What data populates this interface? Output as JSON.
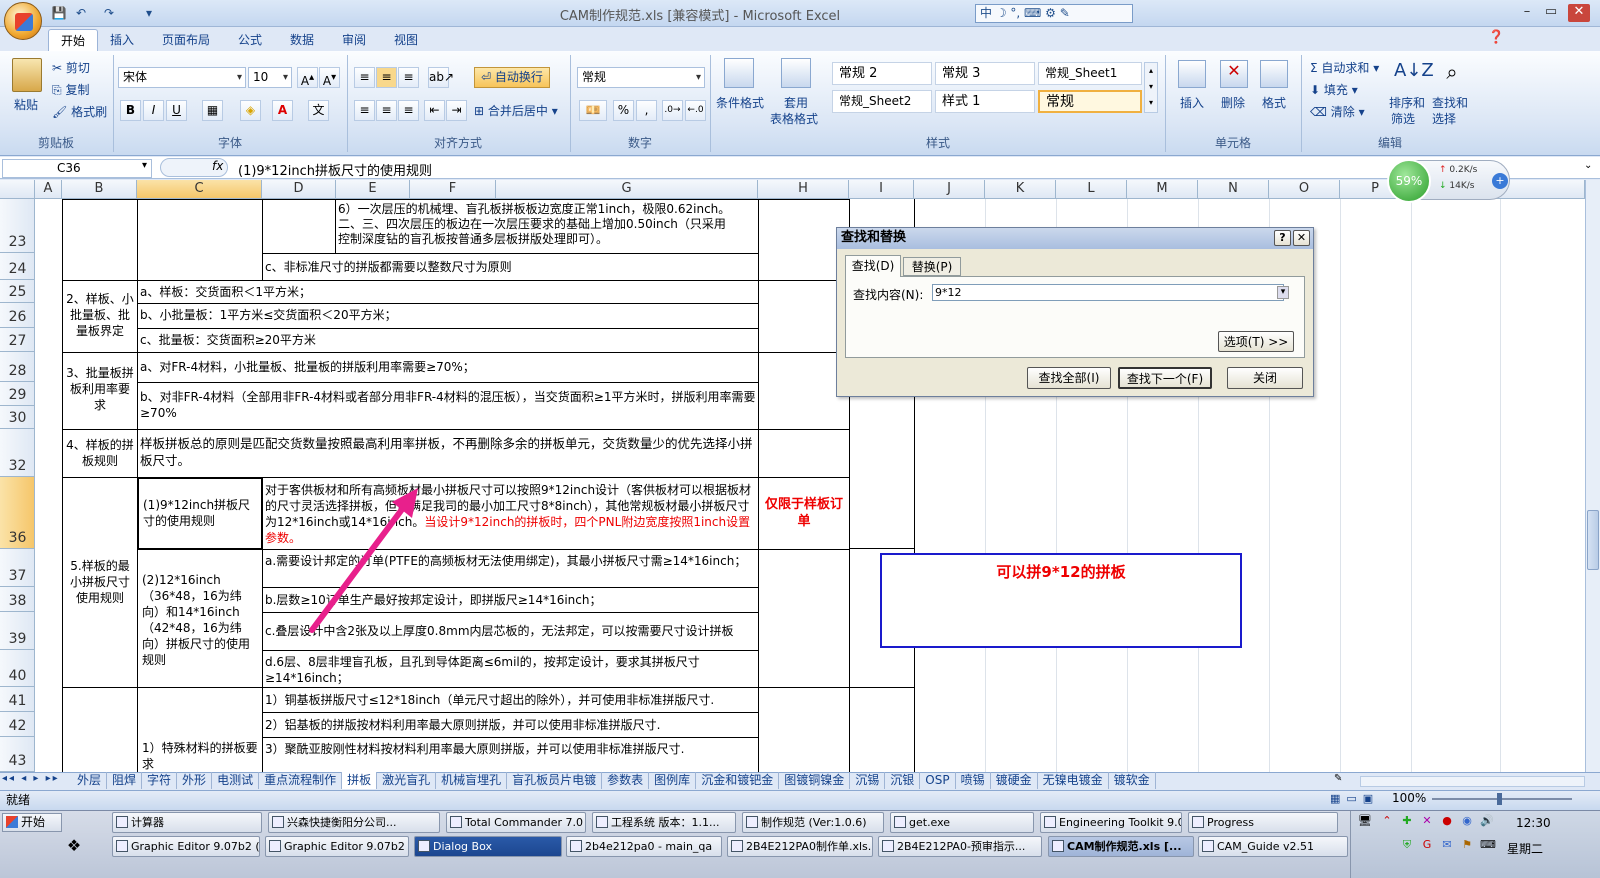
{
  "window": {
    "title": "CAM制作规范.xls  [兼容模式] - Microsoft Excel",
    "ime": "中 ☽ ° ⌨ 👤 🔧",
    "ime_lang": "中"
  },
  "tabs": [
    "开始",
    "插入",
    "页面布局",
    "公式",
    "数据",
    "审阅",
    "视图"
  ],
  "ribbon": {
    "clipboard": {
      "paste": "粘贴",
      "cut": "剪切",
      "copy": "复制",
      "format_painter": "格式刷",
      "label": "剪贴板"
    },
    "font": {
      "name": "宋体",
      "size": "10",
      "bold": "B",
      "italic": "I",
      "underline": "U",
      "label": "字体"
    },
    "alignment": {
      "wrap": "自动换行",
      "merge": "合并后居中",
      "label": "对齐方式"
    },
    "number": {
      "format": "常规",
      "label": "数字",
      "percent": "%",
      "comma": ","
    },
    "styles": {
      "conditional": "条件格式",
      "table": "套用",
      "table2": "表格格式",
      "cells": [
        "常规 2",
        "常规 3",
        "常规_Sheet1",
        "常规_Sheet2",
        "样式 1",
        "常规"
      ],
      "label": "样式"
    },
    "cells": {
      "insert": "插入",
      "delete": "删除",
      "format": "格式",
      "label": "单元格"
    },
    "editing": {
      "autosum": "自动求和",
      "fill": "填充",
      "clear": "清除",
      "sort": "排序和",
      "sort2": "筛选",
      "find": "查找和",
      "find2": "选择",
      "label": "编辑"
    }
  },
  "formula_bar": {
    "name_box": "C36",
    "fx": "fx",
    "content": "(1)9*12inch拼板尺寸的使用规则"
  },
  "columns": [
    "A",
    "B",
    "C",
    "D",
    "E",
    "F",
    "G",
    "H",
    "I",
    "J",
    "K",
    "L",
    "M",
    "N",
    "O",
    "P",
    "R"
  ],
  "rows": [
    "23",
    "24",
    "25",
    "26",
    "27",
    "28",
    "29",
    "30",
    "31",
    "32",
    "36",
    "37",
    "38",
    "39",
    "40",
    "41",
    "42",
    "43"
  ],
  "sheet": {
    "r23_line1": "6）一次层压的机械埋、盲孔板拼板板边宽度正常1inch，极限0.62inch。",
    "r23_line2": "二、三、四次层压的板边在一次层压要求的基础上增加0.50inch（只采用",
    "r23_line3": "控制深度钻的盲孔板按普通多层板拼版处理即可）。",
    "r24": "c、非标准尺寸的拼版都需要以整数尺寸为原则",
    "b25": "2、样板、小批量板、批量板界定",
    "c25": "a、样板：交货面积＜1平方米；",
    "c26": "b、小批量板：1平方米≤交货面积＜20平方米；",
    "c27": "c、批量板：交货面积≥20平方米",
    "b29": "3、批量板拼板利用率要求",
    "c29": "a、对FR-4材料，小批量板、批量板的拼版利用率需要≥70%；",
    "c30": "b、对非FR-4材料（全部用非FR-4材料或者部分用非FR-4材料的混压板），当交货面积≥1平方米时，拼版利用率需要≥70%",
    "b32": "4、样板的拼板规则",
    "c32": "样板拼板总的原则是匹配交货数量按照最高利用率拼板，不再删除多余的拼板单元，交货数量少的优先选择小拼板尺寸。",
    "b36": "5.样板的最小拼板尺寸使用规则",
    "c36": "(1)9*12inch拼板尺寸的使用规则",
    "d36_black": "对于客供板材和所有高频板材最小拼板尺寸可以按照9*12inch设计（客供板材可以根据板材的尺寸灵活选择拼板，但需满足我司的最小加工尺寸8*8inch），其他常规板材最小拼板尺寸为12*16inch或14*16inch。",
    "d36_red": "当设计9*12inch的拼板时，四个PNL附边宽度按照1inch设置参数。",
    "h36": "仅限于样板订单",
    "c37": "(2)12*16inch（36*48，16为纬向）和14*16inch（42*48，16为纬向）拼板尺寸的使用规则",
    "d37": "a.需要设计邦定的订单(PTFE的高频板材无法使用绑定)，其最小拼板尺寸需≥14*16inch；",
    "d38": "b.层数≥10订单生产最好按邦定设计，即拼版尺≥14*16inch；",
    "d39": "c.叠层设计中含2张及以上厚度0.8mm内层芯板的，无法邦定，可以按需要尺寸设计拼板",
    "d40": "d.6层、8层非埋盲孔板，且孔到导体距离≤6mil的，按邦定设计，要求其拼板尺寸≥14*16inch；",
    "d41": "1）铜基板拼版尺寸≤12*18inch（单元尺寸超出的除外），并可使用非标准拼版尺寸.",
    "d42": "2）铝基板的拼版按材料利用率最大原则拼版，并可以使用非标准拼版尺寸.",
    "d43": "3）聚酰亚胺刚性材料按材料利用率最大原则拼版，并可以使用非标准拼版尺寸.",
    "c42": "1）特殊材料的拼板要求",
    "annotation": "可以拼9*12的拼板"
  },
  "dialog": {
    "title": "查找和替换",
    "tab_find": "查找(D)",
    "tab_replace": "替换(P)",
    "find_label": "查找内容(N):",
    "find_value": "9*12",
    "options": "选项(T) >>",
    "find_all": "查找全部(I)",
    "find_next": "查找下一个(F)",
    "close": "关闭"
  },
  "netmeter": {
    "percent": "59%",
    "up": "0.2K/s",
    "down": "14K/s"
  },
  "sheet_tabs": [
    "外层",
    "阻焊",
    "字符",
    "外形",
    "电测试",
    "重点流程制作",
    "拼板",
    "激光盲孔",
    "机械盲埋孔",
    "盲孔板员片电镀",
    "参数表",
    "图例库",
    "沉金和镀钯金",
    "图镀铜镍金",
    "沉锡",
    "沉银",
    "OSP",
    "喷锡",
    "镀硬金",
    "无镍电镀金",
    "镀软金"
  ],
  "status": {
    "ready": "就绪",
    "zoom": "100%"
  },
  "taskbar": {
    "start": "开始",
    "row1": [
      "计算器",
      "兴森快捷衡阳分公司...",
      "Total Commander 7.0 ...",
      "工程系统  版本：1.1...",
      "制作规范 (Ver:1.0.6)",
      "get.exe",
      "Engineering Toolkit 9.0...",
      "Progress"
    ],
    "row2": [
      "Graphic Editor 9.07b2 (...",
      "Graphic Editor 9.07b2 (...",
      "Dialog Box",
      "2b4e212pa0 - main_qa",
      "2B4E212PA0制作单.xls...",
      "2B4E212PA0-预审指示...",
      "CAM制作规范.xls [...",
      "CAM_Guide v2.51"
    ],
    "clock": "12:30",
    "day": "星期二"
  },
  "colors": {
    "accent": "#15428b",
    "annotation_border": "#1a1acc",
    "arrow": "#e8208c",
    "red": "#e00000"
  }
}
